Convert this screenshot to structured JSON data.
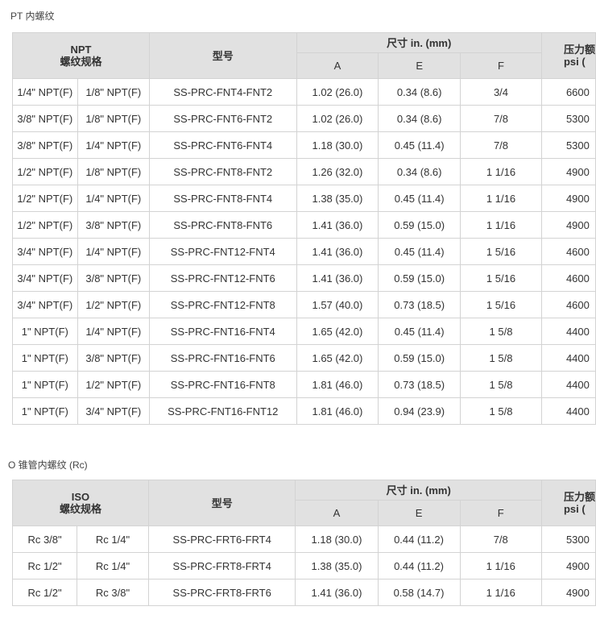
{
  "npt_section": {
    "title": "PT 内螺纹",
    "header": {
      "thread_spec_line1": "NPT",
      "thread_spec_line2": "螺纹规格",
      "model": "型号",
      "dims": "尺寸 in. (mm)",
      "col_a": "A",
      "col_e": "E",
      "col_f": "F",
      "pressure_line1": "压力额",
      "pressure_line2": "psi ("
    },
    "rows": [
      {
        "t1": "1/4\" NPT(F)",
        "t2": "1/8\" NPT(F)",
        "model": "SS-PRC-FNT4-FNT2",
        "a": "1.02 (26.0)",
        "e": "0.34 (8.6)",
        "f": "3/4",
        "p": "6600"
      },
      {
        "t1": "3/8\" NPT(F)",
        "t2": "1/8\" NPT(F)",
        "model": "SS-PRC-FNT6-FNT2",
        "a": "1.02 (26.0)",
        "e": "0.34 (8.6)",
        "f": "7/8",
        "p": "5300"
      },
      {
        "t1": "3/8\" NPT(F)",
        "t2": "1/4\" NPT(F)",
        "model": "SS-PRC-FNT6-FNT4",
        "a": "1.18 (30.0)",
        "e": "0.45 (11.4)",
        "f": "7/8",
        "p": "5300"
      },
      {
        "t1": "1/2\" NPT(F)",
        "t2": "1/8\" NPT(F)",
        "model": "SS-PRC-FNT8-FNT2",
        "a": "1.26 (32.0)",
        "e": "0.34 (8.6)",
        "f": "1 1/16",
        "p": "4900"
      },
      {
        "t1": "1/2\" NPT(F)",
        "t2": "1/4\" NPT(F)",
        "model": "SS-PRC-FNT8-FNT4",
        "a": "1.38 (35.0)",
        "e": "0.45 (11.4)",
        "f": "1 1/16",
        "p": "4900"
      },
      {
        "t1": "1/2\" NPT(F)",
        "t2": "3/8\" NPT(F)",
        "model": "SS-PRC-FNT8-FNT6",
        "a": "1.41 (36.0)",
        "e": "0.59 (15.0)",
        "f": "1 1/16",
        "p": "4900"
      },
      {
        "t1": "3/4\" NPT(F)",
        "t2": "1/4\" NPT(F)",
        "model": "SS-PRC-FNT12-FNT4",
        "a": "1.41 (36.0)",
        "e": "0.45 (11.4)",
        "f": "1 5/16",
        "p": "4600"
      },
      {
        "t1": "3/4\" NPT(F)",
        "t2": "3/8\" NPT(F)",
        "model": "SS-PRC-FNT12-FNT6",
        "a": "1.41 (36.0)",
        "e": "0.59 (15.0)",
        "f": "1 5/16",
        "p": "4600"
      },
      {
        "t1": "3/4\" NPT(F)",
        "t2": "1/2\" NPT(F)",
        "model": "SS-PRC-FNT12-FNT8",
        "a": "1.57 (40.0)",
        "e": "0.73 (18.5)",
        "f": "1 5/16",
        "p": "4600"
      },
      {
        "t1": "1\" NPT(F)",
        "t2": "1/4\" NPT(F)",
        "model": "SS-PRC-FNT16-FNT4",
        "a": "1.65 (42.0)",
        "e": "0.45 (11.4)",
        "f": "1 5/8",
        "p": "4400"
      },
      {
        "t1": "1\" NPT(F)",
        "t2": "3/8\" NPT(F)",
        "model": "SS-PRC-FNT16-FNT6",
        "a": "1.65 (42.0)",
        "e": "0.59 (15.0)",
        "f": "1 5/8",
        "p": "4400"
      },
      {
        "t1": "1\" NPT(F)",
        "t2": "1/2\" NPT(F)",
        "model": "SS-PRC-FNT16-FNT8",
        "a": "1.81 (46.0)",
        "e": "0.73 (18.5)",
        "f": "1 5/8",
        "p": "4400"
      },
      {
        "t1": "1\" NPT(F)",
        "t2": "3/4\" NPT(F)",
        "model": "SS-PRC-FNT16-FNT12",
        "a": "1.81 (46.0)",
        "e": "0.94 (23.9)",
        "f": "1 5/8",
        "p": "4400"
      }
    ]
  },
  "iso_section": {
    "title": "O 锥管内螺纹 (Rc)",
    "header": {
      "thread_spec_line1": "ISO",
      "thread_spec_line2": "螺纹规格",
      "model": "型号",
      "dims": "尺寸 in. (mm)",
      "col_a": "A",
      "col_e": "E",
      "col_f": "F",
      "pressure_line1": "压力额",
      "pressure_line2": "psi ("
    },
    "rows": [
      {
        "t1": "Rc 3/8\"",
        "t2": "Rc 1/4\"",
        "model": "SS-PRC-FRT6-FRT4",
        "a": "1.18 (30.0)",
        "e": "0.44 (11.2)",
        "f": "7/8",
        "p": "5300"
      },
      {
        "t1": "Rc 1/2\"",
        "t2": "Rc 1/4\"",
        "model": "SS-PRC-FRT8-FRT4",
        "a": "1.38 (35.0)",
        "e": "0.44 (11.2)",
        "f": "1 1/16",
        "p": "4900"
      },
      {
        "t1": "Rc 1/2\"",
        "t2": "Rc 3/8\"",
        "model": "SS-PRC-FRT8-FRT6",
        "a": "1.41 (36.0)",
        "e": "0.58 (14.7)",
        "f": "1 1/16",
        "p": "4900"
      }
    ]
  }
}
